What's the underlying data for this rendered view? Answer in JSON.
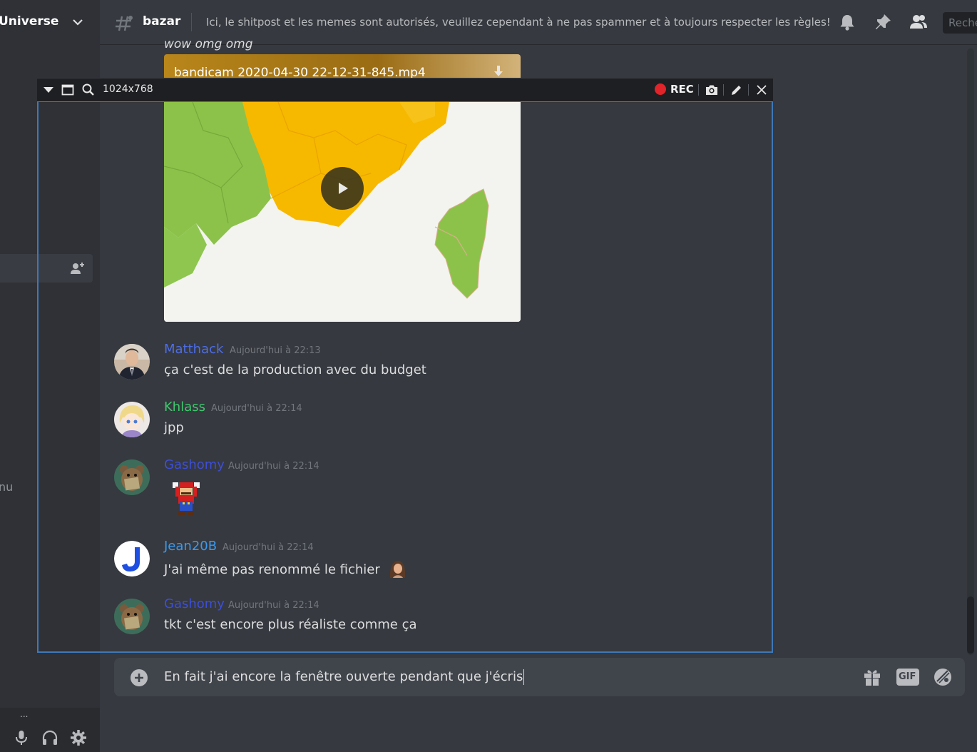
{
  "server": {
    "name": "Universe"
  },
  "channel": {
    "name": "bazar",
    "topic": "Ici, le shitpost et les memes sont autorisés, veuillez cependant à ne pas spammer et à toujours respecter les règles!"
  },
  "header": {
    "search_placeholder": "Reche"
  },
  "sidebar": {
    "partial_text": "nu",
    "user_partial": "..."
  },
  "previous_message": {
    "text": "wow omg omg",
    "file_name": "bandicam 2020-04-30 22-12-31-845.mp4"
  },
  "recorder": {
    "dimensions": "1024x768",
    "rec_label": "REC",
    "accent": "#3f78b8"
  },
  "messages": [
    {
      "author": "Matthack",
      "color": "#4e6ee8",
      "timestamp": "Aujourd'hui à 22:13",
      "text": "ça c'est de la production avec du budget"
    },
    {
      "author": "Khlass",
      "color": "#3ec86c",
      "timestamp": "Aujourd'hui à 22:14",
      "text": "jpp"
    },
    {
      "author": "Gashomy",
      "color": "#3d4ed8",
      "timestamp": "Aujourd'hui à 22:14",
      "text": ""
    },
    {
      "author": "Jean20B",
      "color": "#3b9af0",
      "timestamp": "Aujourd'hui à 22:14",
      "text": "J'ai même pas renommé le fichier"
    },
    {
      "author": "Gashomy",
      "color": "#3d4ed8",
      "timestamp": "Aujourd'hui à 22:14",
      "text": "tkt c'est encore plus réaliste comme ça"
    }
  ],
  "composer": {
    "value": "En fait j'ai encore la fenêtre ouverte pendant que j'écris",
    "gif_label": "GIF"
  },
  "icons": [
    "chevron-down-icon",
    "hash-icon",
    "bell-icon",
    "pin-icon",
    "members-icon",
    "add-member-icon",
    "mic-icon",
    "headphones-icon",
    "gear-icon",
    "dropdown-icon",
    "window-icon",
    "zoom-icon",
    "camera-icon",
    "pencil-icon",
    "close-icon",
    "download-icon",
    "play-icon",
    "plus-icon",
    "gift-icon",
    "gif-icon",
    "sticker-icon",
    "emoji-icon"
  ]
}
